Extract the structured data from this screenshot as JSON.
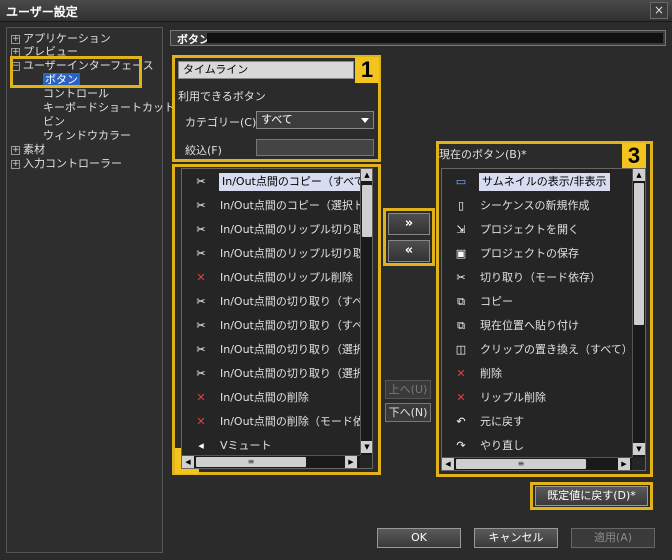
{
  "window": {
    "title": "ユーザー設定",
    "close_glyph": "×"
  },
  "tree": {
    "items": [
      {
        "label": "アプリケーション",
        "expander": "+",
        "selected": false
      },
      {
        "label": "プレビュー",
        "expander": "+",
        "selected": false
      },
      {
        "label": "ユーザーインターフェース",
        "expander": "−",
        "selected": false
      },
      {
        "label": "ボタン",
        "expander": "",
        "selected": true
      },
      {
        "label": "コントロール",
        "expander": "",
        "selected": false
      },
      {
        "label": "キーボードショートカット",
        "expander": "",
        "selected": false
      },
      {
        "label": "ビン",
        "expander": "",
        "selected": false
      },
      {
        "label": "ウィンドウカラー",
        "expander": "",
        "selected": false
      },
      {
        "label": "素材",
        "expander": "+",
        "selected": false
      },
      {
        "label": "入力コントローラー",
        "expander": "+",
        "selected": false
      }
    ]
  },
  "section": {
    "title": "ボタン"
  },
  "panel1": {
    "badge": "1",
    "target_select": "タイムライン",
    "available_label": "利用できるボタン",
    "category_label": "カテゴリー(C)",
    "category_value": "すべて",
    "filter_label": "絞込(F)",
    "filter_value": ""
  },
  "panel2": {
    "badge": "2",
    "items": [
      {
        "icon": "✂",
        "label": "In/Out点間のコピー（すべて",
        "selected": true
      },
      {
        "icon": "✂",
        "label": "In/Out点間のコピー（選択ト",
        "selected": false
      },
      {
        "icon": "✂",
        "label": "In/Out点間のリップル切り取",
        "selected": false
      },
      {
        "icon": "✂",
        "label": "In/Out点間のリップル切り取",
        "selected": false
      },
      {
        "icon": "✕",
        "label": "In/Out点間のリップル削除",
        "selected": false
      },
      {
        "icon": "✂",
        "label": "In/Out点間の切り取り（すべ",
        "selected": false
      },
      {
        "icon": "✂",
        "label": "In/Out点間の切り取り（すべ",
        "selected": false
      },
      {
        "icon": "✂",
        "label": "In/Out点間の切り取り（選択",
        "selected": false
      },
      {
        "icon": "✂",
        "label": "In/Out点間の切り取り（選択",
        "selected": false
      },
      {
        "icon": "✕",
        "label": "In/Out点間の削除",
        "selected": false
      },
      {
        "icon": "✕",
        "label": "In/Out点間の削除（モード依",
        "selected": false
      },
      {
        "icon": "◂",
        "label": "Vミュート",
        "selected": false
      }
    ]
  },
  "transfer": {
    "add_label": "»",
    "remove_label": "«",
    "up_label": "上へ(U)",
    "down_label": "下へ(N)"
  },
  "panel3": {
    "badge": "3",
    "title": "現在のボタン(B)*",
    "items": [
      {
        "icon": "▭",
        "label": "サムネイルの表示/非表示",
        "selected": true
      },
      {
        "icon": "▯",
        "label": "シーケンスの新規作成",
        "selected": false
      },
      {
        "icon": "⇲",
        "label": "プロジェクトを開く",
        "selected": false
      },
      {
        "icon": "▣",
        "label": "プロジェクトの保存",
        "selected": false
      },
      {
        "icon": "✂",
        "label": "切り取り（モード依存）",
        "selected": false
      },
      {
        "icon": "⧉",
        "label": "コピー",
        "selected": false
      },
      {
        "icon": "⧉",
        "label": "現在位置へ貼り付け",
        "selected": false
      },
      {
        "icon": "◫",
        "label": "クリップの置き換え（すべて）",
        "selected": false
      },
      {
        "icon": "✕",
        "label": "削除",
        "selected": false
      },
      {
        "icon": "✕",
        "label": "リップル削除",
        "selected": false
      },
      {
        "icon": "↶",
        "label": "元に戻す",
        "selected": false
      },
      {
        "icon": "↷",
        "label": "やり直し",
        "selected": false
      }
    ]
  },
  "restore_default_label": "既定値に戻す(D)*",
  "footer": {
    "ok_label": "OK",
    "cancel_label": "キャンセル",
    "apply_label": "適用(A)"
  },
  "colors": {
    "accent": "#f2c41d",
    "selection": "#2a63c8"
  }
}
